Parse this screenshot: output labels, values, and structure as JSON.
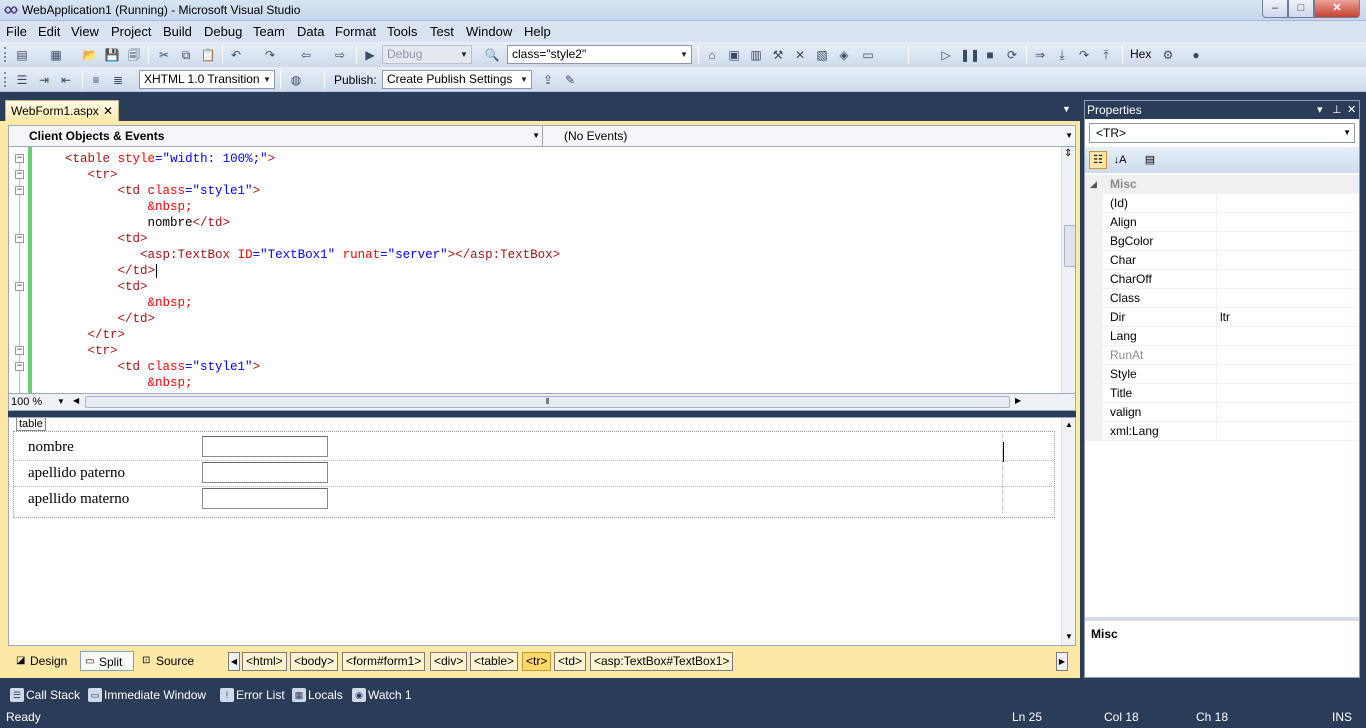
{
  "window": {
    "title": "WebApplication1 (Running) - Microsoft Visual Studio",
    "min": "–",
    "max": "□",
    "close": "✕"
  },
  "menu": [
    "File",
    "Edit",
    "View",
    "Project",
    "Build",
    "Debug",
    "Team",
    "Data",
    "Format",
    "Tools",
    "Test",
    "Window",
    "Help"
  ],
  "toolbar1": {
    "config": "Debug",
    "style_target": "class=\"style2\"",
    "hex": "Hex"
  },
  "toolbar2": {
    "doctype": "XHTML 1.0 Transition",
    "publish_label": "Publish:",
    "publish_value": "Create Publish Settings"
  },
  "doc_tab": {
    "name": "WebForm1.aspx",
    "close": "✕"
  },
  "navbar": {
    "left": "Client Objects & Events",
    "right": "(No Events)"
  },
  "code_lines": [
    {
      "indent": "    ",
      "parts": [
        [
          "tg",
          "<table "
        ],
        [
          "at",
          "style"
        ],
        [
          "bl",
          "=\""
        ],
        [
          "bl",
          "width: 100%;"
        ],
        [
          "bl",
          "\""
        ],
        [
          "tg",
          ">"
        ]
      ]
    },
    {
      "indent": "       ",
      "parts": [
        [
          "tg",
          "<tr>"
        ]
      ]
    },
    {
      "indent": "           ",
      "parts": [
        [
          "tg",
          "<td "
        ],
        [
          "at",
          "class"
        ],
        [
          "bl",
          "=\"style1\""
        ],
        [
          "tg",
          ">"
        ]
      ]
    },
    {
      "indent": "               ",
      "parts": [
        [
          "at",
          "&nbsp;"
        ]
      ]
    },
    {
      "indent": "               ",
      "parts": [
        [
          "tx",
          "nombre"
        ],
        [
          "tg",
          "</td>"
        ]
      ]
    },
    {
      "indent": "           ",
      "parts": [
        [
          "tg",
          "<td>"
        ]
      ]
    },
    {
      "indent": "              ",
      "parts": [
        [
          "tg",
          "<asp:TextBox "
        ],
        [
          "at",
          "ID"
        ],
        [
          "bl",
          "=\"TextBox1\" "
        ],
        [
          "at",
          "runat"
        ],
        [
          "bl",
          "=\"server\""
        ],
        [
          "tg",
          "></asp:TextBox>"
        ]
      ]
    },
    {
      "indent": "           ",
      "parts": [
        [
          "tg",
          "</td>"
        ]
      ]
    },
    {
      "indent": "           ",
      "parts": [
        [
          "tg",
          "<td>"
        ]
      ]
    },
    {
      "indent": "               ",
      "parts": [
        [
          "at",
          "&nbsp;"
        ]
      ]
    },
    {
      "indent": "           ",
      "parts": [
        [
          "tg",
          "</td>"
        ]
      ]
    },
    {
      "indent": "       ",
      "parts": [
        [
          "tg",
          "</tr>"
        ]
      ]
    },
    {
      "indent": "       ",
      "parts": [
        [
          "tg",
          "<tr>"
        ]
      ]
    },
    {
      "indent": "           ",
      "parts": [
        [
          "tg",
          "<td "
        ],
        [
          "at",
          "class"
        ],
        [
          "bl",
          "=\"style1\""
        ],
        [
          "tg",
          ">"
        ]
      ]
    },
    {
      "indent": "               ",
      "parts": [
        [
          "at",
          "&nbsp;"
        ]
      ]
    }
  ],
  "zoom": "100 %",
  "design": {
    "table_tag": "table",
    "rows": [
      "nombre",
      "apellido paterno",
      "apellido materno"
    ]
  },
  "view_buttons": {
    "design": "Design",
    "split": "Split",
    "source": "Source"
  },
  "breadcrumbs": [
    "<html>",
    "<body>",
    "<form#form1>",
    "<div>",
    "<table>",
    "<tr>",
    "<td>",
    "<asp:TextBox#TextBox1>"
  ],
  "properties": {
    "title": "Properties",
    "selected": "<TR>",
    "category": "Misc",
    "rows": [
      {
        "name": "(Id)",
        "value": ""
      },
      {
        "name": "Align",
        "value": ""
      },
      {
        "name": "BgColor",
        "value": ""
      },
      {
        "name": "Char",
        "value": ""
      },
      {
        "name": "CharOff",
        "value": ""
      },
      {
        "name": "Class",
        "value": ""
      },
      {
        "name": "Dir",
        "value": "ltr"
      },
      {
        "name": "Lang",
        "value": ""
      },
      {
        "name": "RunAt",
        "value": "",
        "disabled": true
      },
      {
        "name": "Style",
        "value": ""
      },
      {
        "name": "Title",
        "value": ""
      },
      {
        "name": "valign",
        "value": ""
      },
      {
        "name": "xml:Lang",
        "value": ""
      }
    ],
    "description": "Misc"
  },
  "debug_windows": [
    "Call Stack",
    "Immediate Window",
    "Error List",
    "Locals",
    "Watch 1"
  ],
  "status": {
    "text": "Ready",
    "ln": "Ln 25",
    "col": "Col 18",
    "ch": "Ch 18",
    "mode": "INS"
  }
}
